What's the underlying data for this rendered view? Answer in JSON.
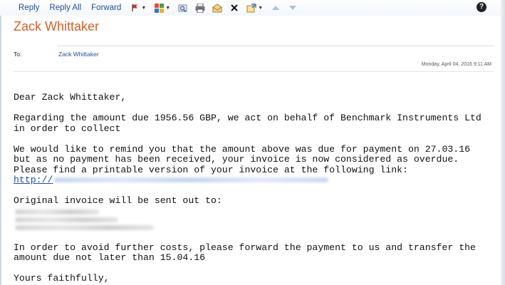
{
  "toolbar": {
    "reply": "Reply",
    "reply_all": "Reply All",
    "forward": "Forward",
    "icons": [
      "flag-icon",
      "categorize-icon",
      "find-icon",
      "print-icon",
      "envelope-icon",
      "delete-icon",
      "move-icon",
      "previous-icon",
      "next-icon",
      "help-icon"
    ],
    "help_glyph": "?"
  },
  "message": {
    "subject": "Zack Whittaker",
    "to_label": "To:",
    "to_value": "Zack Whittaker",
    "date": "Monday, April 04, 2016 9:11 AM"
  },
  "body": {
    "greeting": "Dear Zack Whittaker,",
    "para1_line1": "Regarding the amount due 1956.56 GBP, we act on behalf of Benchmark Instruments Ltd",
    "para1_line2": "in order to collect",
    "para2_line1": "We would like to remind you that the amount above was due for payment on 27.03.16",
    "para2_line2": "but as no payment has been received, your invoice is now considered as overdue.",
    "para2_line3": "Please find a printable version of your invoice at the following link:",
    "link_prefix": "http://",
    "para3": "Original invoice will be sent out to:",
    "para4_line1": "In order to avoid further costs, please forward the payment to us and transfer the",
    "para4_line2": "amount due not later than 15.04.16",
    "closing": "Yours faithfully,"
  },
  "colors": {
    "subject": "#d4602a",
    "link": "#1a4ea8",
    "toolbar_text": "#1f4e9c"
  }
}
